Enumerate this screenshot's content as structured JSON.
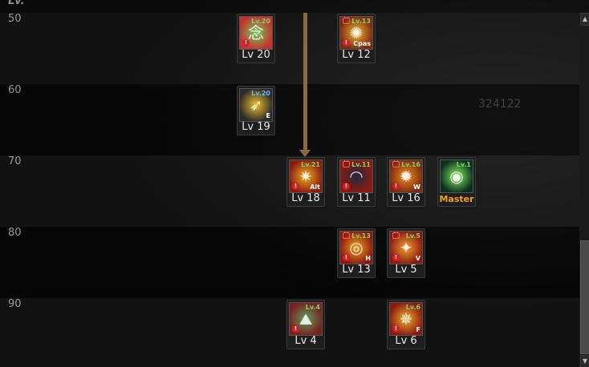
{
  "header": {
    "lv_label": "Lv."
  },
  "background_number": "324122",
  "rows": [
    {
      "level": "50"
    },
    {
      "level": "60"
    },
    {
      "level": "70"
    },
    {
      "level": "80"
    },
    {
      "level": "90"
    }
  ],
  "skills": [
    {
      "id": "s1",
      "tag": "Lv.20",
      "tag_color": "green",
      "locked": false,
      "warn": true,
      "key": "",
      "level_text": "Lv 20",
      "glyph": "念",
      "icon_colors": [
        "#6ad05a",
        "#c83030"
      ]
    },
    {
      "id": "s2",
      "tag": "Lv.13",
      "tag_color": "green",
      "locked": true,
      "warn": true,
      "key": "Cpas",
      "level_text": "Lv 12",
      "glyph": "✺",
      "icon_colors": [
        "#f0b030",
        "#7a2a10"
      ]
    },
    {
      "id": "s3",
      "tag": "Lv.20",
      "tag_color": "blue",
      "locked": false,
      "warn": false,
      "key": "E",
      "level_text": "Lv 19",
      "glyph": "➶",
      "icon_colors": [
        "#f2c030",
        "#2a2a2a"
      ]
    },
    {
      "id": "s4",
      "tag": "Lv.21",
      "tag_color": "green",
      "locked": false,
      "warn": true,
      "key": "Alt",
      "level_text": "Lv 18",
      "glyph": "✷",
      "icon_colors": [
        "#f0b020",
        "#8a1a10"
      ]
    },
    {
      "id": "s5",
      "tag": "Lv.11",
      "tag_color": "green",
      "locked": true,
      "warn": true,
      "key": "",
      "level_text": "Lv 11",
      "glyph": "◠",
      "icon_colors": [
        "#202a40",
        "#8a1a10"
      ]
    },
    {
      "id": "s6",
      "tag": "Lv.16",
      "tag_color": "green",
      "locked": true,
      "warn": true,
      "key": "W",
      "level_text": "Lv 16",
      "glyph": "✹",
      "icon_colors": [
        "#f09020",
        "#7a2a10"
      ]
    },
    {
      "id": "s7",
      "tag": "Lv.1",
      "tag_color": "green",
      "locked": false,
      "warn": false,
      "key": "",
      "level_text": "Master",
      "glyph": "◉",
      "icon_colors": [
        "#8af060",
        "#0a3020"
      ],
      "master": true
    },
    {
      "id": "s8",
      "tag": "Lv.13",
      "tag_color": "green",
      "locked": true,
      "warn": true,
      "key": "H",
      "level_text": "Lv 13",
      "glyph": "◎",
      "icon_colors": [
        "#f0a020",
        "#8a1a10"
      ]
    },
    {
      "id": "s9",
      "tag": "Lv.5",
      "tag_color": "green",
      "locked": true,
      "warn": true,
      "key": "V",
      "level_text": "Lv 5",
      "glyph": "✦",
      "icon_colors": [
        "#f0a030",
        "#8a1a10"
      ]
    },
    {
      "id": "s10",
      "tag": "Lv.4",
      "tag_color": "green",
      "locked": false,
      "warn": true,
      "key": "",
      "level_text": "Lv 4",
      "glyph": "⛰",
      "icon_colors": [
        "#5aa060",
        "#7a2020"
      ]
    },
    {
      "id": "s11",
      "tag": "Lv.6",
      "tag_color": "green",
      "locked": false,
      "warn": true,
      "key": "F",
      "level_text": "Lv 6",
      "glyph": "✵",
      "icon_colors": [
        "#f0b030",
        "#8a1a10"
      ]
    }
  ]
}
